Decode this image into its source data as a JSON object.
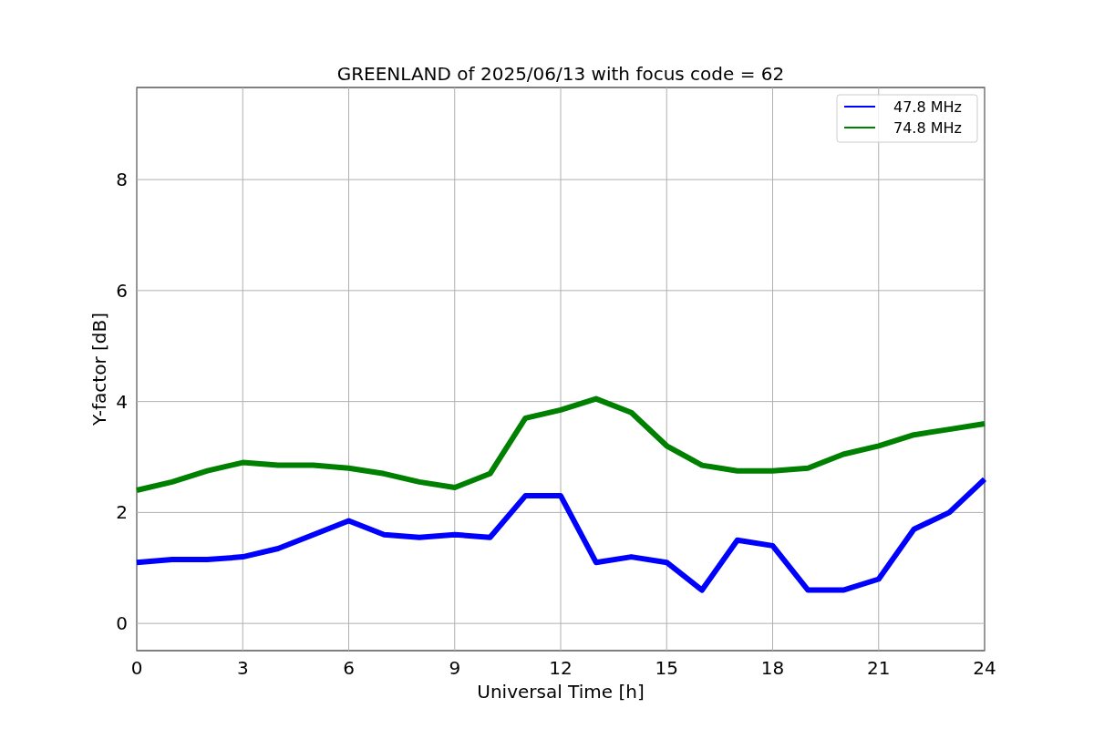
{
  "chart_data": {
    "type": "line",
    "title": "GREENLAND of 2025/06/13 with focus code = 62",
    "xlabel": "Universal Time [h]",
    "ylabel": "Y-factor [dB]",
    "x": [
      0,
      1,
      2,
      3,
      4,
      5,
      6,
      7,
      8,
      9,
      10,
      11,
      12,
      13,
      14,
      15,
      16,
      17,
      18,
      19,
      20,
      21,
      22,
      23,
      24
    ],
    "series": [
      {
        "name": "47.8 MHz",
        "color": "#0000ff",
        "values": [
          1.1,
          1.15,
          1.15,
          1.2,
          1.35,
          1.6,
          1.85,
          1.6,
          1.55,
          1.6,
          1.55,
          2.3,
          2.3,
          1.1,
          1.2,
          1.1,
          0.6,
          1.5,
          1.4,
          0.6,
          0.6,
          0.8,
          1.7,
          2.0,
          2.6
        ]
      },
      {
        "name": "74.8 MHz",
        "color": "#008000",
        "values": [
          2.4,
          2.55,
          2.75,
          2.9,
          2.85,
          2.85,
          2.8,
          2.7,
          2.55,
          2.45,
          2.7,
          3.7,
          3.85,
          4.05,
          3.8,
          3.2,
          2.85,
          2.75,
          2.75,
          2.8,
          3.05,
          3.2,
          3.4,
          3.5,
          3.6
        ]
      }
    ],
    "grid": true,
    "legend": true,
    "xlim": [
      0,
      24
    ],
    "ylim": [
      -0.49,
      9.66
    ],
    "xticks": [
      0,
      3,
      6,
      9,
      12,
      15,
      18,
      21,
      24
    ],
    "yticks": [
      0,
      2,
      4,
      6,
      8
    ]
  }
}
